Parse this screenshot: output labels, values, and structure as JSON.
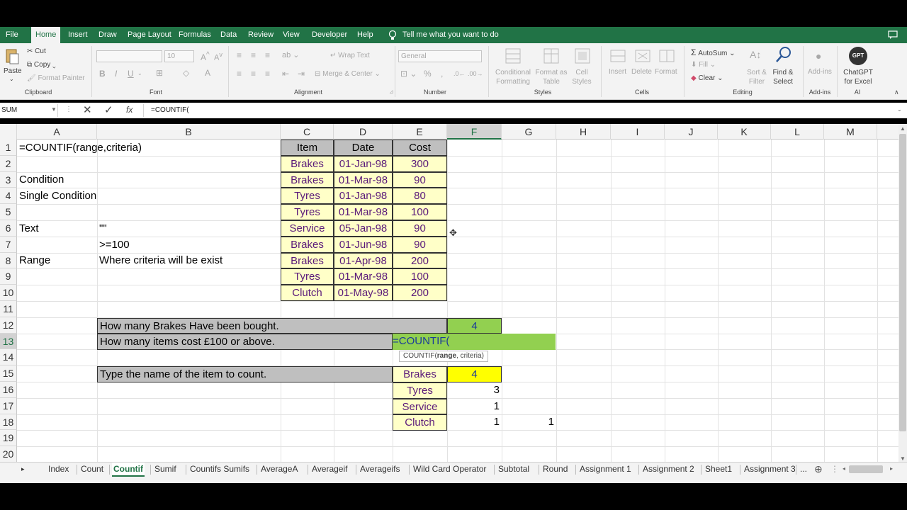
{
  "menu": {
    "items": [
      "File",
      "Home",
      "Insert",
      "Draw",
      "Page Layout",
      "Formulas",
      "Data",
      "Review",
      "View",
      "Developer",
      "Help"
    ],
    "tellme": "Tell me what you want to do"
  },
  "ribbon": {
    "clipboard": {
      "paste": "Paste",
      "cut": "Cut",
      "copy": "Copy",
      "format_painter": "Format Painter",
      "label": "Clipboard"
    },
    "font": {
      "size": "10",
      "label": "Font"
    },
    "alignment": {
      "wrap": "Wrap Text",
      "merge": "Merge & Center",
      "label": "Alignment"
    },
    "number": {
      "format": "General",
      "label": "Number"
    },
    "styles": {
      "conditional": "Conditional Formatting",
      "format_table": "Format as Table",
      "cell_styles": "Cell Styles",
      "label": "Styles"
    },
    "cells": {
      "insert": "Insert",
      "delete": "Delete",
      "format": "Format",
      "label": "Cells"
    },
    "editing": {
      "autosum": "AutoSum",
      "fill": "Fill",
      "clear": "Clear",
      "sort": "Sort & Filter",
      "find": "Find & Select",
      "label": "Editing"
    },
    "addins": {
      "addins": "Add-ins",
      "label": "Add-ins"
    },
    "ai": {
      "chatgpt": "ChatGPT for Excel",
      "gpt_badge": "GPT",
      "label": "AI"
    }
  },
  "formula_bar": {
    "name_box": "SUM",
    "formula": "=COUNTIF("
  },
  "columns": [
    "A",
    "B",
    "C",
    "D",
    "E",
    "F",
    "G",
    "H",
    "I",
    "J",
    "K",
    "L",
    "M"
  ],
  "rows": [
    "1",
    "2",
    "3",
    "4",
    "5",
    "6",
    "7",
    "8",
    "9",
    "10",
    "11",
    "12",
    "13",
    "14",
    "15",
    "16",
    "17",
    "18",
    "19",
    "20"
  ],
  "cells": {
    "a1": "=COUNTIF(range,criteria)",
    "a3": "Condition",
    "a4": "Single Condition",
    "a6": "Text",
    "b6": "\"\"",
    "b7": ">=100",
    "a8": "Range",
    "b8": "Where criteria will be exist"
  },
  "table": {
    "headers": [
      "Item",
      "Date",
      "Cost"
    ],
    "rows": [
      [
        "Brakes",
        "01-Jan-98",
        "300"
      ],
      [
        "Brakes",
        "01-Mar-98",
        "90"
      ],
      [
        "Tyres",
        "01-Jan-98",
        "80"
      ],
      [
        "Tyres",
        "01-Mar-98",
        "100"
      ],
      [
        "Service",
        "05-Jan-98",
        "90"
      ],
      [
        "Brakes",
        "01-Jun-98",
        "90"
      ],
      [
        "Brakes",
        "01-Apr-98",
        "200"
      ],
      [
        "Tyres",
        "01-Mar-98",
        "100"
      ],
      [
        "Clutch",
        "01-May-98",
        "200"
      ]
    ]
  },
  "questions": {
    "q12": "How many Brakes Have been bought.",
    "f12": "4",
    "q13": "How many items cost £100 or above.",
    "e13": "=COUNTIF(",
    "tooltip_fn": "COUNTIF(",
    "tooltip_bold": "range",
    "tooltip_rest": ", criteria)",
    "q15": "Type the name of the item to count.",
    "e15": "Brakes",
    "f15": "4",
    "e16": "Tyres",
    "f16": "3",
    "e17": "Service",
    "f17": "1",
    "e18": "Clutch",
    "f18": "1",
    "g18": "1"
  },
  "tabs": [
    "Index",
    "Count",
    "Countif",
    "Sumif",
    "Countifs Sumifs",
    "AverageA",
    "Averageif",
    "Averageifs",
    "Wild Card Operator",
    "Subtotal",
    "Round",
    "Assignment 1",
    "Assignment 2",
    "Sheet1",
    "Assignment 3",
    "..."
  ],
  "active_tab": "Countif",
  "colors": {
    "excel_green": "#217346",
    "table_yellow": "#ffffc8",
    "highlight_green": "#92d050",
    "bright_yellow": "#ffff00"
  }
}
